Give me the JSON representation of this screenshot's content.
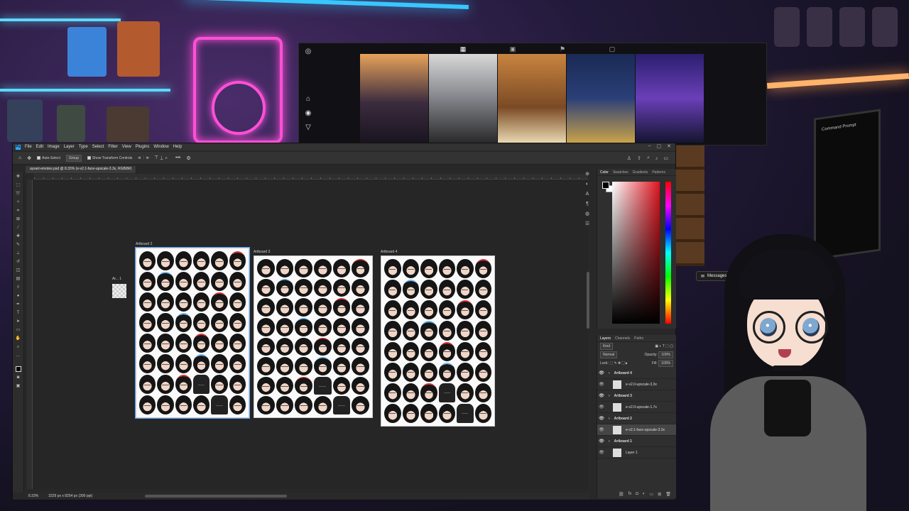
{
  "photoshop": {
    "menu": [
      "File",
      "Edit",
      "Image",
      "Layer",
      "Type",
      "Select",
      "Filter",
      "View",
      "Plugins",
      "Window",
      "Help"
    ],
    "options": {
      "auto_select": "Auto-Select",
      "group_select": "Group",
      "show_transform": "Show Transform Controls"
    },
    "doc_tab": "aysart-emotes.psd @ 8.33% (e-v2.1-face-upscale-3.3x, RGB/8#)",
    "zoom": "8.33%",
    "doc_size": "3229 px x 8254 px (300 ppi)",
    "artboards": {
      "ab1_label": "Ar... 1",
      "ab2_label": "Artboard 2",
      "ab3_label": "Artboard 3",
      "ab4_label": "Artboard 4"
    },
    "color_panel": {
      "tabs": [
        "Color",
        "Swatches",
        "Gradients",
        "Patterns"
      ]
    },
    "layers_panel": {
      "tabs": [
        "Layers",
        "Channels",
        "Paths"
      ],
      "kind": "Kind",
      "blend": "Normal",
      "opacity_label": "Opacity:",
      "opacity": "100%",
      "lock_label": "Lock:",
      "fill_label": "Fill:",
      "fill": "100%",
      "layers": [
        {
          "name": "Artboard 4",
          "group": true
        },
        {
          "name": "e-v2.0-upscale-3.3x",
          "group": false
        },
        {
          "name": "Artboard 3",
          "group": true
        },
        {
          "name": "e-v2.0-upscale-1.7x",
          "group": false
        },
        {
          "name": "Artboard 2",
          "group": true
        },
        {
          "name": "e-v2.1-face-upscale-3.3x",
          "group": false
        },
        {
          "name": "Artboard 1",
          "group": true
        },
        {
          "name": "Layer 1",
          "group": false
        }
      ]
    }
  },
  "messages_label": "Messages",
  "terminal_title": "Command Prompt",
  "colors": {
    "accent_ps": "#31a8ff",
    "neon_pink": "#ff4fd8",
    "neon_blue": "#38c6ff"
  }
}
